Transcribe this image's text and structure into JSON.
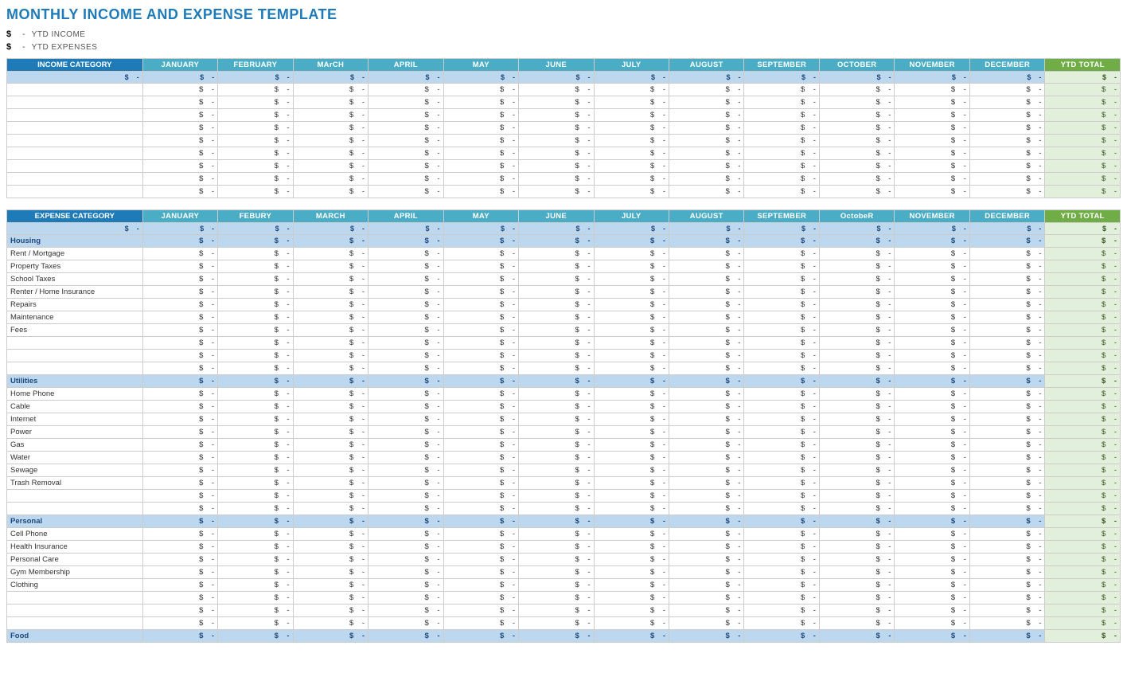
{
  "title": "MONTHLY INCOME AND EXPENSE TEMPLATE",
  "ytd": {
    "income_label": "YTD INCOME",
    "expense_label": "YTD EXPENSES",
    "dollar": "$",
    "bullet": "-"
  },
  "months": [
    "JANUARY",
    "FEBRUARY",
    "MARCH",
    "APRIL",
    "MAY",
    "JUNE",
    "JULY",
    "AUGUST",
    "SEPTEMBER",
    "OCTOBER",
    "NOVEMBER",
    "DECEMBER"
  ],
  "months_expense": [
    "JANUARY",
    "FEBURY",
    "MARCH",
    "APRIL",
    "MAY",
    "JUNE",
    "JULY",
    "AUGUST",
    "SEPTEMBER",
    "OCTOBER",
    "NOVEMBER",
    "DECEMBER"
  ],
  "income": {
    "category_label": "INCOME CATEGORY",
    "ytd_label": "YTD TOTAL",
    "rows": [
      {
        "name": "",
        "values": [
          "-",
          "-",
          "-",
          "-",
          "-",
          "-",
          "-",
          "-",
          "-",
          "-",
          "-",
          "-"
        ],
        "ytd": "-"
      },
      {
        "name": "",
        "values": [
          "-",
          "-",
          "-",
          "-",
          "-",
          "-",
          "-",
          "-",
          "-",
          "-",
          "-",
          "-"
        ],
        "ytd": "-"
      },
      {
        "name": "",
        "values": [
          "-",
          "-",
          "-",
          "-",
          "-",
          "-",
          "-",
          "-",
          "-",
          "-",
          "-",
          "-"
        ],
        "ytd": "-"
      },
      {
        "name": "",
        "values": [
          "-",
          "-",
          "-",
          "-",
          "-",
          "-",
          "-",
          "-",
          "-",
          "-",
          "-",
          "-"
        ],
        "ytd": "-"
      },
      {
        "name": "",
        "values": [
          "-",
          "-",
          "-",
          "-",
          "-",
          "-",
          "-",
          "-",
          "-",
          "-",
          "-",
          "-"
        ],
        "ytd": "-"
      },
      {
        "name": "",
        "values": [
          "-",
          "-",
          "-",
          "-",
          "-",
          "-",
          "-",
          "-",
          "-",
          "-",
          "-",
          "-"
        ],
        "ytd": "-"
      },
      {
        "name": "",
        "values": [
          "-",
          "-",
          "-",
          "-",
          "-",
          "-",
          "-",
          "-",
          "-",
          "-",
          "-",
          "-"
        ],
        "ytd": "-"
      },
      {
        "name": "",
        "values": [
          "-",
          "-",
          "-",
          "-",
          "-",
          "-",
          "-",
          "-",
          "-",
          "-",
          "-",
          "-"
        ],
        "ytd": "-"
      },
      {
        "name": "",
        "values": [
          "-",
          "-",
          "-",
          "-",
          "-",
          "-",
          "-",
          "-",
          "-",
          "-",
          "-",
          "-"
        ],
        "ytd": "-"
      }
    ]
  },
  "expense": {
    "category_label": "EXPENSE CATEGORY",
    "ytd_label": "YTD TOTAL",
    "sections": [
      {
        "name": "Housing",
        "rows": [
          {
            "name": "Rent / Mortgage"
          },
          {
            "name": "Property Taxes"
          },
          {
            "name": "School Taxes"
          },
          {
            "name": "Renter / Home Insurance"
          },
          {
            "name": "Repairs"
          },
          {
            "name": "Maintenance"
          },
          {
            "name": "Fees"
          },
          {
            "name": ""
          },
          {
            "name": ""
          },
          {
            "name": ""
          }
        ]
      },
      {
        "name": "Utilities",
        "rows": [
          {
            "name": "Home Phone"
          },
          {
            "name": "Cable"
          },
          {
            "name": "Internet"
          },
          {
            "name": "Power"
          },
          {
            "name": "Gas"
          },
          {
            "name": "Water"
          },
          {
            "name": "Sewage"
          },
          {
            "name": "Trash Removal"
          },
          {
            "name": ""
          },
          {
            "name": ""
          }
        ]
      },
      {
        "name": "Personal",
        "rows": [
          {
            "name": "Cell Phone"
          },
          {
            "name": "Health Insurance"
          },
          {
            "name": "Personal Care"
          },
          {
            "name": "Gym Membership"
          },
          {
            "name": "Clothing"
          },
          {
            "name": ""
          },
          {
            "name": ""
          },
          {
            "name": ""
          }
        ]
      },
      {
        "name": "Food",
        "rows": []
      }
    ]
  }
}
